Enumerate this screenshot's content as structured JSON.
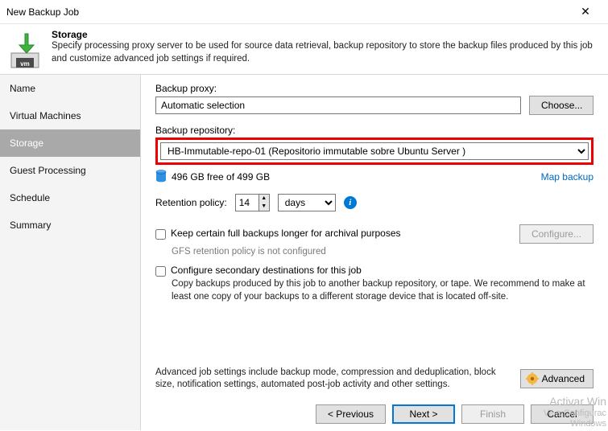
{
  "window": {
    "title": "New Backup Job",
    "close": "✕"
  },
  "header": {
    "title": "Storage",
    "desc": "Specify processing proxy server to be used for source data retrieval, backup repository to store the backup files produced by this job and customize advanced job settings if required."
  },
  "sidebar": {
    "items": [
      "Name",
      "Virtual Machines",
      "Storage",
      "Guest Processing",
      "Schedule",
      "Summary"
    ],
    "selected": 2
  },
  "proxy": {
    "label": "Backup proxy:",
    "value": "Automatic selection",
    "choose": "Choose..."
  },
  "repo": {
    "label": "Backup repository:",
    "value": "HB-Immutable-repo-01 (Repositorio immutable sobre Ubuntu Server )",
    "free": "496 GB free of 499 GB",
    "map": "Map backup"
  },
  "retention": {
    "label": "Retention policy:",
    "value": "14",
    "unit": "days"
  },
  "gfs": {
    "label": "Keep certain full backups longer for archival purposes",
    "sub": "GFS retention policy is not configured",
    "configure": "Configure..."
  },
  "secondary": {
    "label": "Configure secondary destinations for this job",
    "desc": "Copy backups produced by this job to another backup repository, or tape. We recommend to make at least one copy of your backups to a different storage device that is located off-site."
  },
  "advanced": {
    "text": "Advanced job settings include backup mode, compression and deduplication, block size, notification settings, automated post-job activity and other settings.",
    "btn": "Advanced"
  },
  "footer": {
    "prev": "< Previous",
    "next": "Next >",
    "finish": "Finish",
    "cancel": "Cancel"
  },
  "watermark": {
    "l1": "Activar Win",
    "l2": "Ve a Configurac",
    "l3": "Windows"
  }
}
